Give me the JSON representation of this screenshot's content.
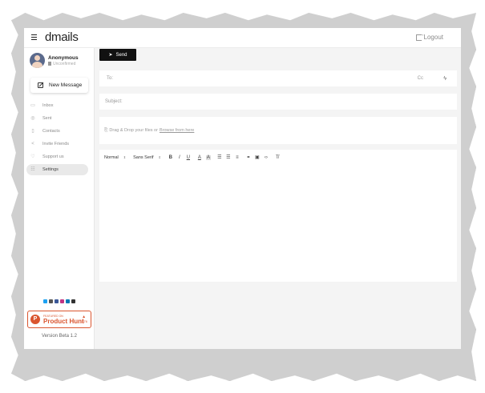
{
  "app": {
    "logo": "dmails",
    "logout_label": "Logout"
  },
  "profile": {
    "name": "Anonymous",
    "status": "Unconfirmed"
  },
  "sidebar": {
    "new_message_label": "New Message",
    "items": [
      {
        "label": "Inbox",
        "icon": "inbox-icon",
        "active": false
      },
      {
        "label": "Sent",
        "icon": "sent-icon",
        "active": false
      },
      {
        "label": "Contacts",
        "icon": "contacts-icon",
        "active": false
      },
      {
        "label": "Invite Friends",
        "icon": "share-icon",
        "active": false
      },
      {
        "label": "Support us",
        "icon": "heart-icon",
        "active": false
      },
      {
        "label": "Settings",
        "icon": "settings-icon",
        "active": true
      }
    ],
    "socials": [
      {
        "name": "twitter-icon",
        "color": "#1da1f2"
      },
      {
        "name": "github-icon",
        "color": "#555555"
      },
      {
        "name": "facebook-icon",
        "color": "#3b5998"
      },
      {
        "name": "instagram-icon",
        "color": "#c13584"
      },
      {
        "name": "linkedin-icon",
        "color": "#0077b5"
      },
      {
        "name": "youtube-icon",
        "color": "#333333"
      }
    ],
    "product_hunt": {
      "featured": "FEATURED ON",
      "title": "Product Hunt",
      "logo_letter": "P",
      "votes": "1576",
      "color": "#da552f"
    },
    "version": "Version Beta 1.2"
  },
  "compose": {
    "send_label": "Send",
    "to_label": "To:",
    "cc_label": "Cc",
    "subject_label": "Subject:",
    "drop_text": "Drag & Drop your files or",
    "browse_text": "Browse from here",
    "toolbar": {
      "size": "Normal",
      "font": "Sans Serif"
    }
  }
}
